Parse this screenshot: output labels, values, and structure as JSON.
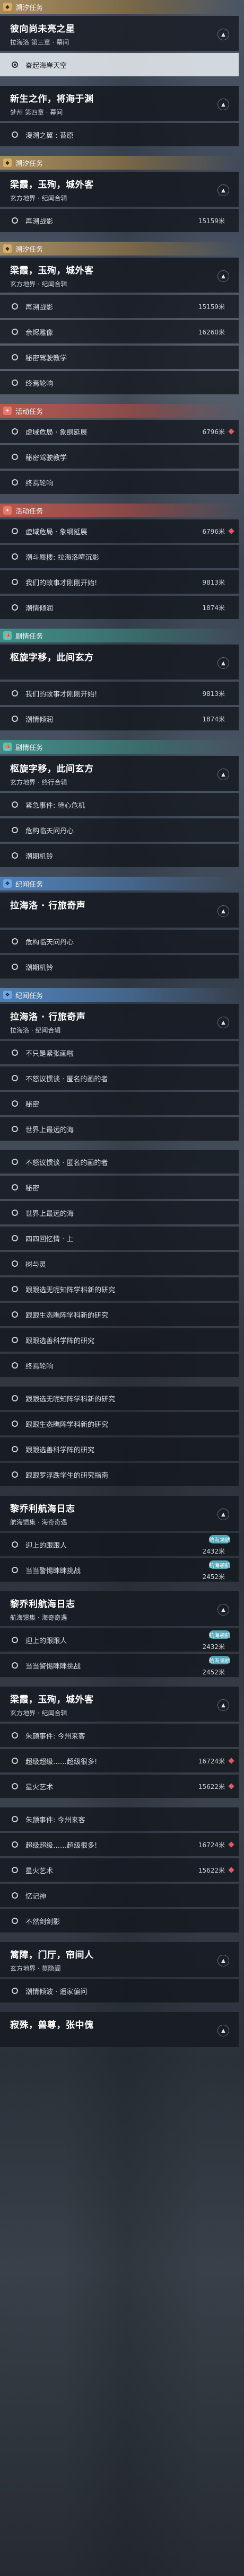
{
  "quest_list": [
    {
      "kind": "gold",
      "header": "溯汐任务",
      "title": "彼向尚未亮之星",
      "sub": "拉海洛 第三章 · 幕间",
      "steps": [
        {
          "text": "奋起海岸天空",
          "highlight": true
        }
      ],
      "collapsed": false
    },
    {
      "kind": "gold",
      "header": "",
      "title": "新生之作，将海于渊",
      "sub": "梦州 第四章 · 幕间",
      "steps": [
        {
          "text": "漫溯之翼 : 苔原"
        }
      ],
      "collapsed": false
    },
    {
      "kind": "gold",
      "header": "溯汐任务",
      "title": "梁霞，玉殉，城外客",
      "sub": "玄方地界 · 纪闻合辑",
      "steps": [
        {
          "text": "再溯战影",
          "dist": "15159米"
        }
      ]
    },
    {
      "kind": "gold",
      "header": "溯汐任务",
      "title": "梁霞，玉殉，城外客",
      "sub": "玄方地界 · 纪闻合辑",
      "steps": [
        {
          "text": "再溯战影",
          "dist": "15159米"
        },
        {
          "text": "余烬雕像",
          "dist": "16260米"
        },
        {
          "text": "秘密驾驶教学"
        },
        {
          "text": "终焉轮响"
        }
      ]
    },
    {
      "kind": "red",
      "header": "活动任务",
      "steps": [
        {
          "text": "虚域危局 · 象纲延展",
          "dist": "6796米",
          "mark": true
        },
        {
          "text": "秘密驾驶教学"
        },
        {
          "text": "终焉轮响"
        }
      ]
    },
    {
      "kind": "red",
      "header": "活动任务",
      "steps": [
        {
          "text": "虚域危局 · 象纲延展",
          "dist": "6796米",
          "mark": true
        },
        {
          "text": "潮斗蜃楼: 拉海洛喧沉影"
        },
        {
          "text": "我们的故事才刚刚开始!",
          "dist": "9813米"
        },
        {
          "text": "潮情倾润",
          "dist": "1874米"
        }
      ]
    },
    {
      "kind": "teal",
      "header": "剧情任务",
      "title": "枢旋字移，此间玄方",
      "sub": "",
      "steps": [
        {
          "text": "我们的故事才刚刚开始!",
          "dist": "9813米"
        },
        {
          "text": "潮情倾润",
          "dist": "1874米"
        }
      ]
    },
    {
      "kind": "teal",
      "header": "剧情任务",
      "title": "枢旋字移，此间玄方",
      "sub": "玄方地界 · 终行合辑",
      "steps": [
        {
          "text": "紧急事件: 待心危机"
        },
        {
          "text": "危构临天问丹心"
        },
        {
          "text": "潮期机铃"
        }
      ]
    },
    {
      "kind": "blue",
      "header": "纪闻任务",
      "title": "拉海洛 · 行旅奇声",
      "sub": "",
      "steps": [
        {
          "text": "危构临天问丹心"
        },
        {
          "text": "潮期机铃"
        }
      ]
    },
    {
      "kind": "blue",
      "header": "纪闻任务",
      "title": "拉海洛 · 行旅奇声",
      "sub": "拉海洛 · 纪闻合辑",
      "steps": [
        {
          "text": "不只是紧张画啦"
        },
        {
          "text": "不怒议惯谈 · 匿名的画的者"
        },
        {
          "text": "秘密"
        },
        {
          "text": "世界上最远的海"
        }
      ]
    },
    {
      "kind": "none",
      "steps": [
        {
          "text": "不怒议惯谈 · 匿名的画的者"
        },
        {
          "text": "秘密"
        },
        {
          "text": "世界上最远的海"
        },
        {
          "text": "四四回忆情 · 上"
        },
        {
          "text": "树与灵"
        },
        {
          "text": "跟跟选无呢知阵学科新的研究"
        },
        {
          "text": "跟跟生态瞧阵学科新的研究"
        },
        {
          "text": "跟跟选善科学阵的研究"
        },
        {
          "text": "终焉轮响"
        }
      ]
    },
    {
      "kind": "none",
      "steps": [
        {
          "text": "跟跟选无呢知阵学科新的研究"
        },
        {
          "text": "跟跟生态瞧阵学科新的研究"
        },
        {
          "text": "跟跟选善科学阵的研究"
        },
        {
          "text": "跟跟罗浮跌学生的研究指南"
        }
      ]
    },
    {
      "kind": "none",
      "title": "黎乔利航海日志",
      "sub": "航海馈集 · 海奇奇遇",
      "steps": [
        {
          "text": "迎上的跟跟人",
          "dist": "2432米",
          "tag": "航海领航"
        },
        {
          "text": "当当警惕眯眯挑战",
          "dist": "2452米",
          "tag": "航海领航"
        }
      ]
    },
    {
      "kind": "none",
      "title": "黎乔利航海日志",
      "sub": "航海馈集 · 海奇奇遇",
      "steps": [
        {
          "text": "迎上的跟跟人",
          "dist": "2432米",
          "tag": "航海领航"
        },
        {
          "text": "当当警惕眯眯挑战",
          "dist": "2452米",
          "tag": "航海领航"
        }
      ]
    },
    {
      "kind": "none",
      "title": "梁霞，玉殉，城外客",
      "sub": "玄方地界 · 纪闻合辑",
      "steps": [
        {
          "text": "朱颜事件: 今州来客"
        },
        {
          "text": "超级超级……超级很多!",
          "dist": "16724米",
          "mark": true
        },
        {
          "text": "星火艺术",
          "dist": "15622米",
          "mark": true
        }
      ]
    },
    {
      "kind": "none",
      "steps": [
        {
          "text": "朱颜事件: 今州来客"
        },
        {
          "text": "超级超级……超级很多!",
          "dist": "16724米",
          "mark": true
        },
        {
          "text": "星火艺术",
          "dist": "15622米",
          "mark": true
        },
        {
          "text": "忆记神"
        },
        {
          "text": "不然剑剑影"
        }
      ]
    },
    {
      "kind": "none",
      "title": "篱障，门厅，帘间人",
      "sub": "玄方地界 · 莫隐阁",
      "steps": [
        {
          "text": "潮情倾波 · 遥家偏问"
        }
      ]
    },
    {
      "kind": "none",
      "title": "寂殊，兽尊，张中傀",
      "sub": "",
      "steps": []
    }
  ],
  "icons": {
    "gold": "scroll-icon",
    "red": "flame-icon",
    "teal": "ship-icon",
    "blue": "book-icon"
  }
}
